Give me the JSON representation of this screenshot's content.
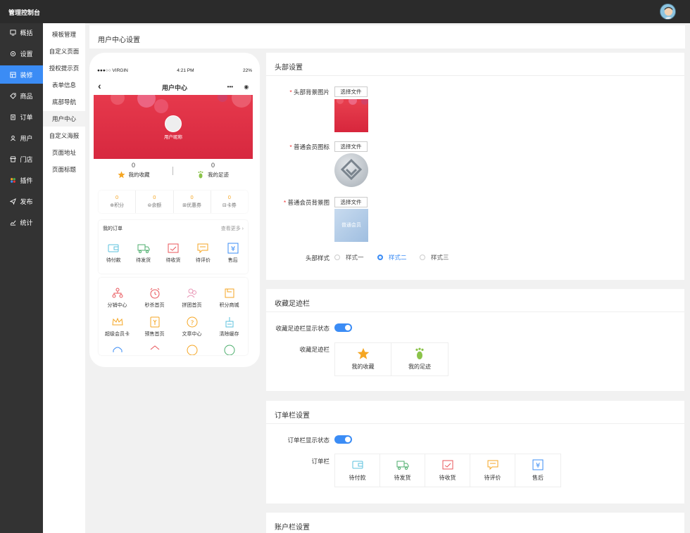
{
  "app": {
    "title": "管理控制台"
  },
  "sidebar": {
    "items": [
      {
        "label": "概括",
        "icon": "dashboard-icon"
      },
      {
        "label": "设置",
        "icon": "gear-icon"
      },
      {
        "label": "装修",
        "icon": "layout-icon",
        "active": true
      },
      {
        "label": "商品",
        "icon": "tag-icon"
      },
      {
        "label": "订单",
        "icon": "clipboard-icon"
      },
      {
        "label": "用户",
        "icon": "user-icon"
      },
      {
        "label": "门店",
        "icon": "store-icon"
      },
      {
        "label": "插件",
        "icon": "plugin-icon"
      },
      {
        "label": "发布",
        "icon": "send-icon"
      },
      {
        "label": "统计",
        "icon": "chart-icon"
      }
    ]
  },
  "subnav": {
    "items": [
      "模板管理",
      "自定义页面",
      "授权提示页",
      "表单信息",
      "底部导航",
      "用户中心",
      "自定义海报",
      "页面地址",
      "页面标题"
    ],
    "active": "用户中心"
  },
  "page": {
    "title": "用户中心设置"
  },
  "phone": {
    "carrier": "●●●○○ VIRGIN",
    "time": "4:21 PM",
    "battery": "22%",
    "nav_title": "用户中心",
    "back_glyph": "‹",
    "capsule_more": "•••",
    "capsule_close": "◉",
    "nickname": "用户昵称",
    "favorites": {
      "count": "0",
      "label": "我的收藏"
    },
    "footprints": {
      "count": "0",
      "label": "我的足迹"
    },
    "assets": [
      {
        "value": "0",
        "label": "积分",
        "icon": "⊕"
      },
      {
        "value": "0",
        "label": "余额",
        "icon": "⊜"
      },
      {
        "value": "0",
        "label": "优惠券",
        "icon": "⊞"
      },
      {
        "value": "0",
        "label": "卡券",
        "icon": "⊟"
      }
    ],
    "orders_card": {
      "title": "我的订单",
      "more": "查看更多 ›",
      "items": [
        "待付款",
        "待发货",
        "待收货",
        "待评价",
        "售后"
      ]
    },
    "menu_rows": [
      [
        "分销中心",
        "秒杀首页",
        "拼团首页",
        "积分商城"
      ],
      [
        "超级会员卡",
        "预售首页",
        "文章中心",
        "清除缓存"
      ]
    ]
  },
  "header_settings": {
    "title": "头部设置",
    "bg_label": "头部背景图片",
    "icon_label": "普通会员图标",
    "vip_bg_label": "普通会员背景图",
    "vip_card_text": "普通会员",
    "choose_file": "选择文件",
    "style_label": "头部样式",
    "styles": [
      "样式一",
      "样式二",
      "样式三"
    ],
    "selected_style": "样式二"
  },
  "fav_settings": {
    "title": "收藏足迹栏",
    "status_label": "收藏足迹栏显示状态",
    "bar_label": "收藏足迹栏",
    "items": [
      "我的收藏",
      "我的足迹"
    ]
  },
  "order_settings": {
    "title": "订单栏设置",
    "status_label": "订单栏显示状态",
    "bar_label": "订单栏",
    "items": [
      "待付款",
      "待发货",
      "待收货",
      "待评价",
      "售后"
    ]
  },
  "account_settings": {
    "title": "账户栏设置"
  },
  "colors": {
    "accent": "#3b8cf5",
    "sidebar": "#333333",
    "topbar": "#2b2b2b",
    "banner": "#e0314a"
  }
}
